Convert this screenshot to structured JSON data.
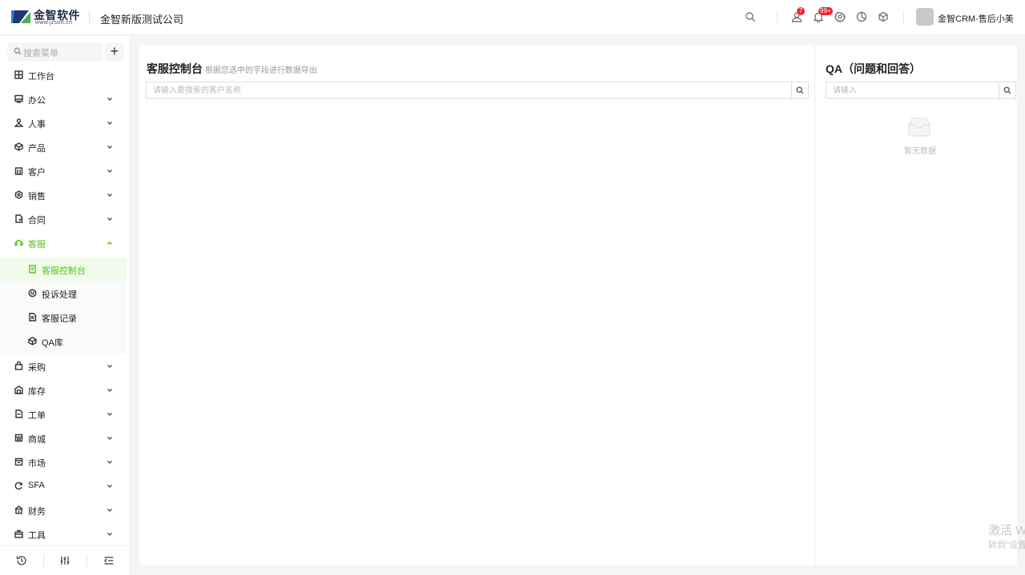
{
  "header": {
    "logo_text": "金智软件",
    "logo_sub": "www.jzsoft.cn",
    "company": "金智新版测试公司",
    "badges": {
      "contacts": "7",
      "notifications": "99+"
    },
    "user_name": "金智CRM-售后小美"
  },
  "sidebar": {
    "search_placeholder": "搜索菜单",
    "add_label": "+",
    "items": [
      {
        "label": "工作台",
        "icon": "workbench-icon"
      },
      {
        "label": "办公",
        "icon": "office-icon"
      },
      {
        "label": "人事",
        "icon": "hr-icon"
      },
      {
        "label": "产品",
        "icon": "product-icon"
      },
      {
        "label": "客户",
        "icon": "customer-icon"
      },
      {
        "label": "销售",
        "icon": "sales-icon"
      },
      {
        "label": "合同",
        "icon": "contract-icon"
      },
      {
        "label": "客服",
        "icon": "service-icon"
      }
    ],
    "sub_items": [
      {
        "label": "客服控制台",
        "icon": "console-icon"
      },
      {
        "label": "投诉处理",
        "icon": "complaint-icon"
      },
      {
        "label": "客服记录",
        "icon": "record-icon"
      },
      {
        "label": "QA库",
        "icon": "qa-icon"
      }
    ],
    "items_after": [
      {
        "label": "采购",
        "icon": "purchase-icon"
      },
      {
        "label": "库存",
        "icon": "inventory-icon"
      },
      {
        "label": "工单",
        "icon": "workorder-icon"
      },
      {
        "label": "商城",
        "icon": "mall-icon"
      },
      {
        "label": "市场",
        "icon": "market-icon"
      },
      {
        "label": "SFA",
        "icon": "sfa-icon"
      },
      {
        "label": "财务",
        "icon": "finance-icon"
      },
      {
        "label": "工具",
        "icon": "tools-icon"
      }
    ],
    "accent_color": "#52c41a"
  },
  "main": {
    "title": "客服控制台",
    "subtitle": "根据您选中的字段进行数据导出",
    "search_placeholder": "请输入要搜索的客户名称",
    "qa_title": "QA（问题和回答）",
    "qa_search_placeholder": "请输入",
    "qa_empty": "暂无数据"
  },
  "watermark": {
    "line1": "激活 W",
    "line2": "转到\"设置"
  }
}
